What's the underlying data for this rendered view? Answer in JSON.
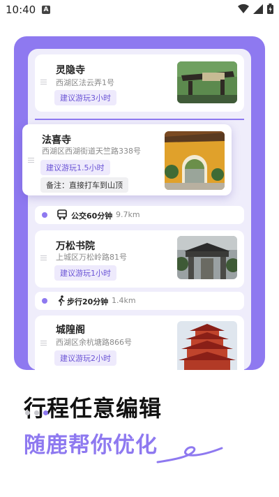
{
  "status_bar": {
    "time": "10:40",
    "notification_glyph": "A"
  },
  "itinerary": [
    {
      "name": "灵隐寺",
      "address": "西湖区法云弄1号",
      "suggestion": "建议游玩3小时"
    },
    {
      "name": "法喜寺",
      "address": "西湖区西湖街道天竺路338号",
      "suggestion": "建议游玩1.5小时",
      "note": "备注：直接打车到山顶"
    },
    {
      "name": "万松书院",
      "address": "上城区万松岭路81号",
      "suggestion": "建议游玩1小时"
    },
    {
      "name": "城隍阁",
      "address": "西湖区余杭塘路866号",
      "suggestion": "建议游玩2小时"
    }
  ],
  "transits": [
    {
      "mode_icon": "bus-icon",
      "label": "公交60分钟",
      "distance": "9.7km"
    },
    {
      "mode_icon": "walk-icon",
      "label": "步行20分钟",
      "distance": "1.4km"
    }
  ],
  "promo": {
    "headline": "行程任意编辑",
    "subline": "随鹿帮你优化"
  },
  "colors": {
    "accent": "#8e79f0",
    "panel": "#efedfb"
  }
}
